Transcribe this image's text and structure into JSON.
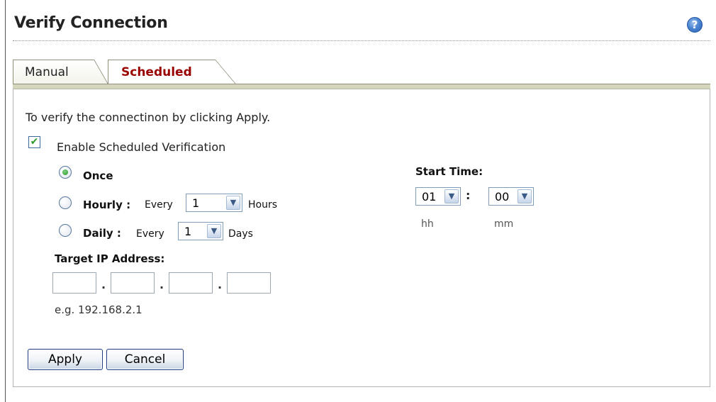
{
  "header": {
    "title": "Verify Connection",
    "help_icon": "help-icon"
  },
  "tabs": [
    {
      "label": "Manual",
      "active": false
    },
    {
      "label": "Scheduled",
      "active": true
    }
  ],
  "panel": {
    "instruction": "To verify the connectinon by clicking Apply.",
    "enable_checkbox": {
      "label": "Enable Scheduled Verification",
      "checked": true
    },
    "schedule": {
      "once": {
        "label": "Once",
        "selected": true
      },
      "hourly": {
        "label": "Hourly :",
        "every": "Every",
        "value": "1",
        "unit": "Hours",
        "selected": false
      },
      "daily": {
        "label": "Daily :",
        "every": "Every",
        "value": "1",
        "unit": "Days",
        "selected": false
      }
    },
    "target_ip": {
      "label": "Target IP Address:",
      "octets": [
        "",
        "",
        "",
        ""
      ],
      "separator": ".",
      "example": "e.g. 192.168.2.1"
    },
    "start_time": {
      "label": "Start Time:",
      "hour": "01",
      "minute": "00",
      "separator": ":",
      "hour_unit": "hh",
      "minute_unit": "mm"
    }
  },
  "buttons": {
    "apply": "Apply",
    "cancel": "Cancel"
  },
  "colors": {
    "active_tab_text": "#990000",
    "tab_bar": "#d6d6bf",
    "checkmark": "#2c9a2c"
  }
}
